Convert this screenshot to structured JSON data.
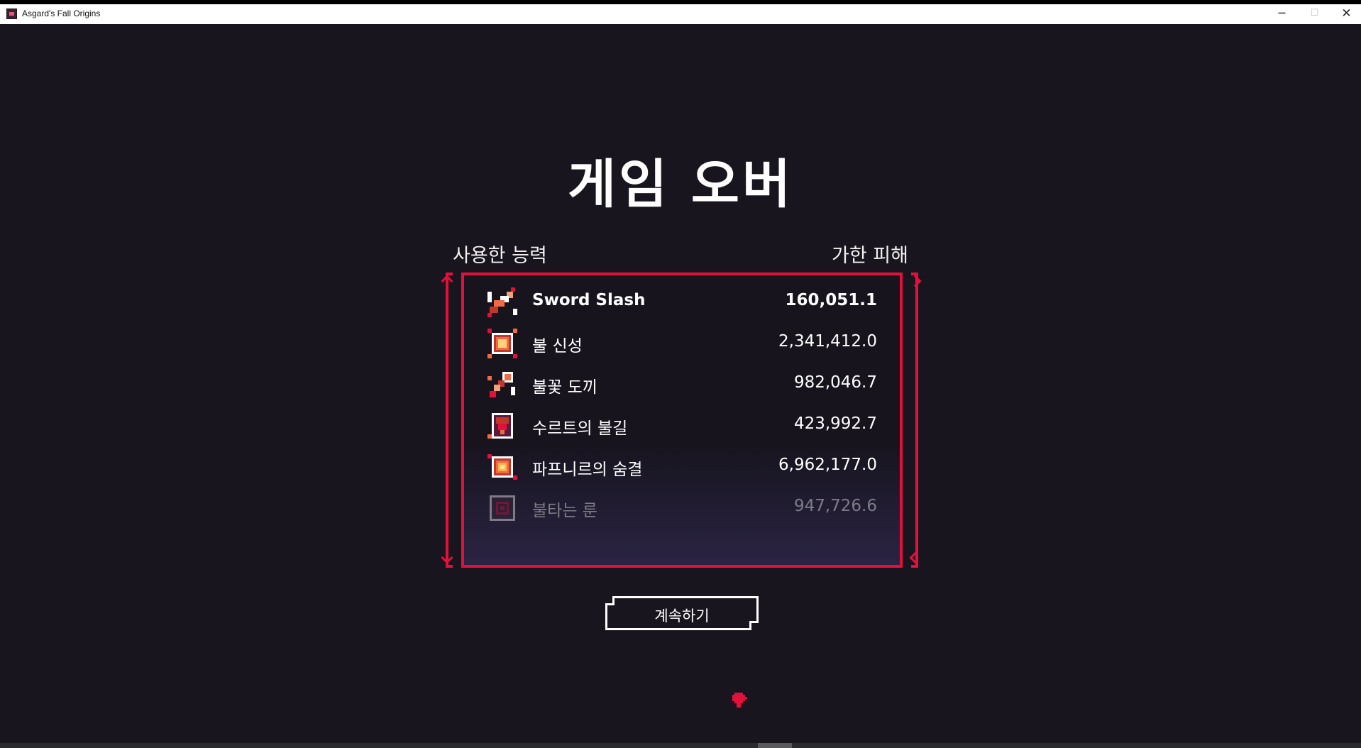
{
  "window": {
    "title": "Asgard's Fall Origins",
    "minimize_glyph": "─",
    "maximize_glyph": "☐",
    "close_glyph": "✕"
  },
  "screen": {
    "title": "게임 오버",
    "left_header": "사용한 능력",
    "right_header": "가한 피해"
  },
  "abilities": [
    {
      "name": "Sword Slash",
      "damage": "160,051.1",
      "icon": "sword-slash-icon"
    },
    {
      "name": "불 신성",
      "damage": "2,341,412.0",
      "icon": "fire-nova-icon"
    },
    {
      "name": "불꽃 도끼",
      "damage": "982,046.7",
      "icon": "flame-axe-icon"
    },
    {
      "name": "수르트의 불길",
      "damage": "423,992.7",
      "icon": "surtr-flame-icon"
    },
    {
      "name": "파프니르의 숨결",
      "damage": "6,962,177.0",
      "icon": "fafnir-breath-icon"
    },
    {
      "name": "불타는 룬",
      "damage": "947,726.6",
      "icon": "burning-rune-icon"
    }
  ],
  "continue_button": {
    "label": "계속하기"
  },
  "colors": {
    "background": "#18151f",
    "accent": "#e3103c",
    "text": "#ffffff"
  }
}
